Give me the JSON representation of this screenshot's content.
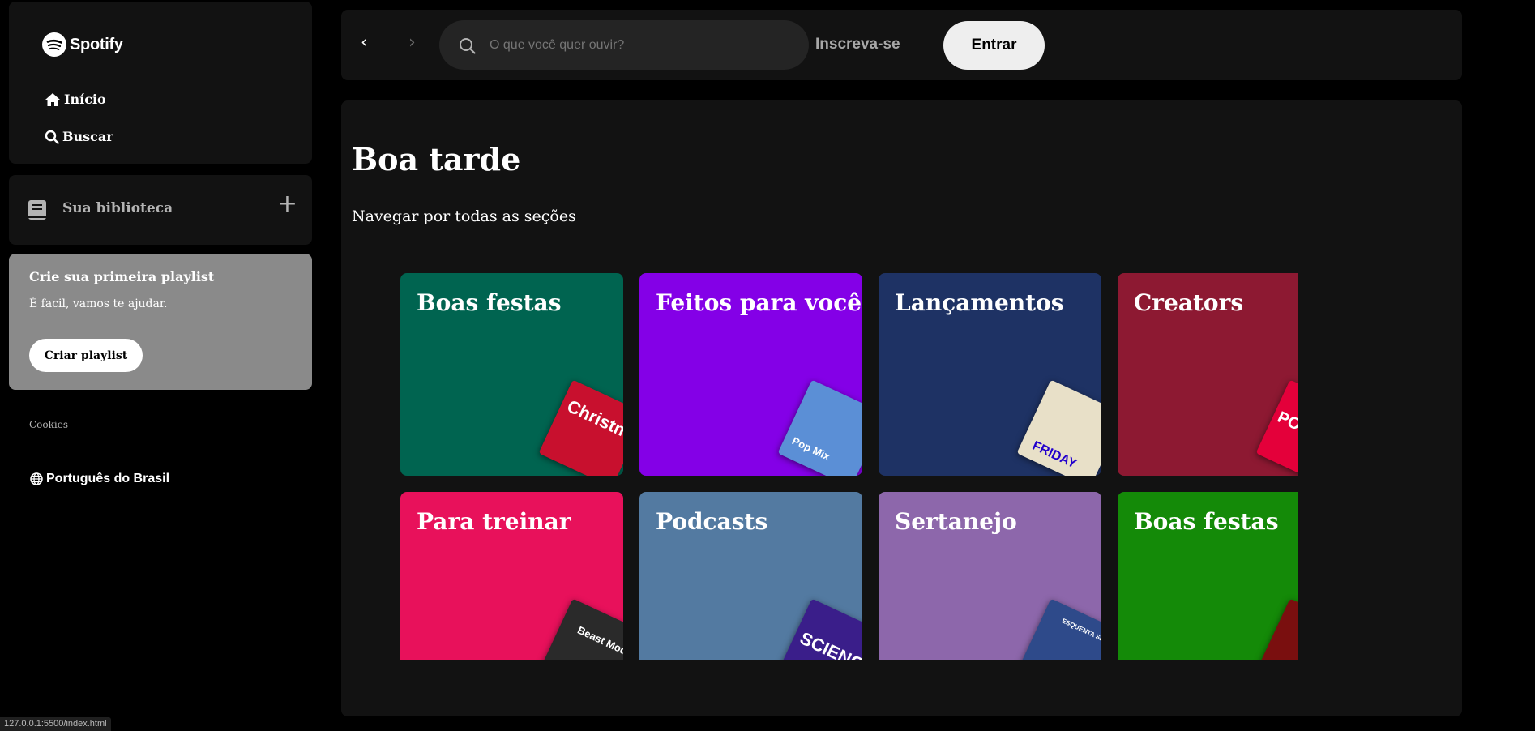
{
  "sidebar": {
    "logo_text": "Spotify",
    "nav": [
      {
        "label": "Início",
        "icon": "home-icon"
      },
      {
        "label": "Buscar",
        "icon": "search-icon"
      }
    ],
    "library": {
      "label": "Sua biblioteca",
      "add_symbol": "+"
    },
    "playlist_card": {
      "title": "Crie sua primeira playlist",
      "subtitle": "É facil, vamos te ajudar.",
      "button_label": "Criar playlist"
    },
    "cookies_label": "Cookies",
    "language_label": "Português do Brasil"
  },
  "topbar": {
    "back_glyph": "‹",
    "forward_glyph": "›",
    "search_placeholder": "O que você quer ouvir?",
    "signup_label": "Inscreva-se",
    "login_label": "Entrar"
  },
  "main": {
    "greeting": "Boa tarde",
    "browse_label": "Navegar por todas as seções",
    "cards": [
      {
        "title": "Boas festas",
        "color": "#006450",
        "art_text": "Christmas Hits",
        "art_color": "#c8102e"
      },
      {
        "title": "Feitos para você",
        "color": "#8400e7",
        "art_text": "Pop Mix",
        "art_color": "#5b8fd6"
      },
      {
        "title": "Lançamentos",
        "color": "#1e3264",
        "art_text": "FRIDAY",
        "art_color": "#e8e0c8"
      },
      {
        "title": "Creators",
        "color": "#8d1932",
        "art_text": "POD DELAS",
        "art_color": "#e4003a"
      },
      {
        "title": "Para treinar",
        "color": "#e8115b",
        "art_text": "Beast Mode",
        "art_color": "#2a2a2a"
      },
      {
        "title": "Podcasts",
        "color": "#537aa1",
        "art_text": "SCIENCE",
        "art_color": "#3a1e8a"
      },
      {
        "title": "Sertanejo",
        "color": "#8d67ab",
        "art_text": "ESQUENTA SERTANEJO",
        "art_color": "#2e4a8a"
      },
      {
        "title": "Boas festas",
        "color": "#148a08",
        "art_text": "",
        "art_color": "#7a0f0f"
      }
    ]
  },
  "status_bar": {
    "url": "127.0.0.1:5500/index.html"
  }
}
